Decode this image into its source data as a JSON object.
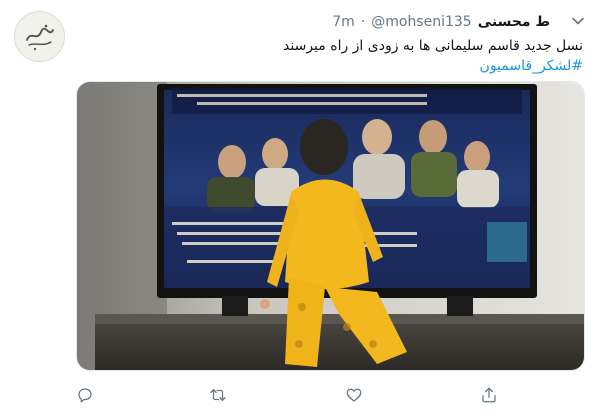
{
  "tweet": {
    "author": {
      "display_name": "ط محسنی",
      "handle": "@mohseni135",
      "separator": "·",
      "time": "7m"
    },
    "text_line_1": "نسل جدید قاسم سلیمانی ها به زودی از راه میرسند",
    "hashtag": "#لشکر_قاسمیون"
  },
  "icons": {
    "chevron": "chevron-down-icon",
    "reply": "reply-icon",
    "retweet": "retweet-icon",
    "like": "heart-icon",
    "share": "share-icon"
  },
  "colors": {
    "link": "#1b95e0",
    "text": "#14171a",
    "secondary": "#657786",
    "icon": "#657786"
  }
}
